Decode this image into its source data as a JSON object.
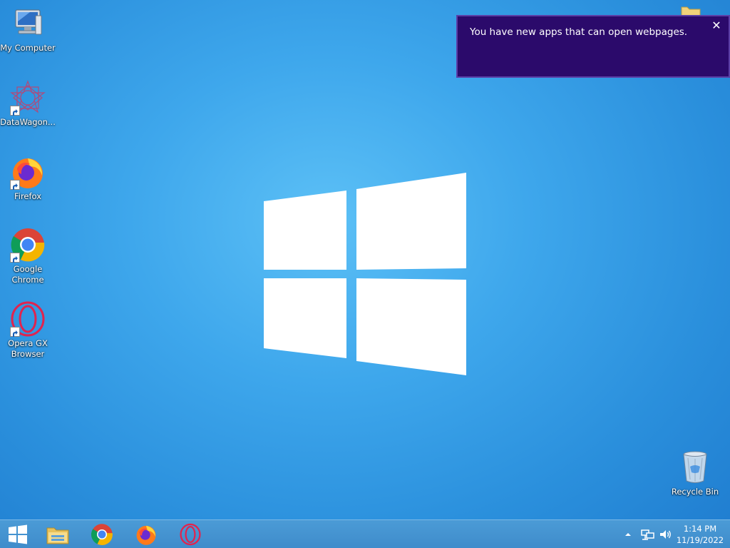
{
  "desktop": {
    "icons": [
      {
        "label": "My Computer",
        "icon": "my-computer-icon"
      },
      {
        "label": "DataWagon...",
        "icon": "datawagon-icon"
      },
      {
        "label": "Firefox",
        "icon": "firefox-icon"
      },
      {
        "label": "Google Chrome",
        "icon": "chrome-icon"
      },
      {
        "label": "Opera GX Browser",
        "icon": "opera-gx-icon"
      },
      {
        "label": "Recycle Bin",
        "icon": "recycle-bin-icon"
      }
    ]
  },
  "toast": {
    "message": "You have new apps that can open webpages.",
    "close_glyph": "✕"
  },
  "taskbar": {
    "pinned": [
      "start-button",
      "file-explorer",
      "google-chrome",
      "firefox",
      "opera-gx"
    ],
    "clock": {
      "time": "1:14 PM",
      "date": "11/19/2022"
    }
  },
  "colors": {
    "toast_bg": "#2b0a6b",
    "taskbar_bg": "#4b9bd6",
    "desktop_bg": "#3ea7ec"
  }
}
